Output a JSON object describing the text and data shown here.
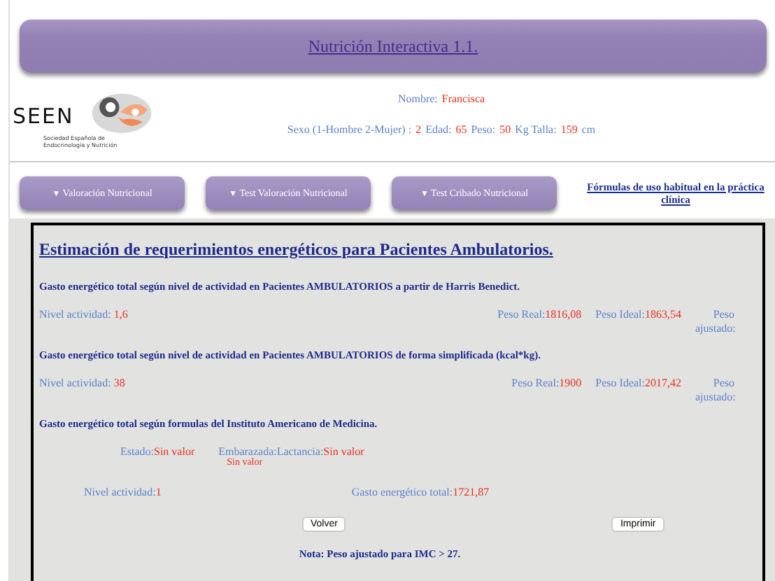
{
  "header": {
    "title": "Nutrición Interactiva 1.1."
  },
  "logo": {
    "name": "SEEN",
    "subtitle": [
      "Sociedad Española de",
      "Endocrinología y Nutrición"
    ]
  },
  "patient": {
    "name_label": "Nombre:",
    "name_value": "Francisca",
    "fields": [
      {
        "kind": "label",
        "text": "Sexo (1-Hombre 2-Mujer) :"
      },
      {
        "kind": "value",
        "text": "2"
      },
      {
        "kind": "label",
        "text": "Edad:"
      },
      {
        "kind": "value",
        "text": "65"
      },
      {
        "kind": "label",
        "text": "Peso:"
      },
      {
        "kind": "value",
        "text": "50"
      },
      {
        "kind": "label",
        "text": "Kg Talla:"
      },
      {
        "kind": "value",
        "text": "159"
      },
      {
        "kind": "label",
        "text": "cm"
      }
    ]
  },
  "nav": {
    "menus": [
      {
        "arrow": "▼",
        "label": "Valoración Nutricional"
      },
      {
        "arrow": "▼",
        "label": "Test Valoración Nutricional"
      },
      {
        "arrow": "▼",
        "label": "Test Cribado Nutricional"
      }
    ],
    "link": "Fórmulas de uso habitual en la práctica clínica"
  },
  "section": {
    "title": "Estimación de requerimientos energéticos para Pacientes Ambulatorios.",
    "blocks": [
      {
        "kind": "weights",
        "title": "Gasto energético total según nivel de actividad en Pacientes AMBULATORIOS a partir de Harris Benedict.",
        "activity": {
          "label": "Nivel actividad:",
          "value": "1,6"
        },
        "weights": [
          {
            "label": "Peso Real:",
            "value": "1816,08"
          },
          {
            "label": "Peso Ideal:",
            "value": "1863,54"
          },
          {
            "label": "Peso ajustado:"
          }
        ]
      },
      {
        "kind": "weights",
        "title": "Gasto energético total según nivel de actividad en Pacientes AMBULATORIOS de forma simplificada (kcal*kg).",
        "activity": {
          "label": "Nivel actividad:",
          "value": "38"
        },
        "weights": [
          {
            "label": "Peso Real:",
            "value": "1900"
          },
          {
            "label": "Peso Ideal:",
            "value": "2017,42"
          },
          {
            "label": "Peso ajustado:"
          }
        ]
      },
      {
        "kind": "iom",
        "title": "Gasto energético total según formulas del Instituto Americano de Medicina.",
        "state": {
          "label": "Estado:",
          "value": "Sin valor"
        },
        "pregnancy": {
          "label": "Embarazada:Lactancia:",
          "value": "Sin valor",
          "extra": "Sin valor"
        },
        "activity": {
          "label": "Nivel actividad:",
          "value": "1"
        },
        "total": {
          "label": "Gasto energético total:",
          "value": "1721,87"
        }
      }
    ],
    "buttons": [
      "Volver",
      "Imprimir"
    ],
    "note": "Nota: Peso ajustado para IMC > 27."
  }
}
